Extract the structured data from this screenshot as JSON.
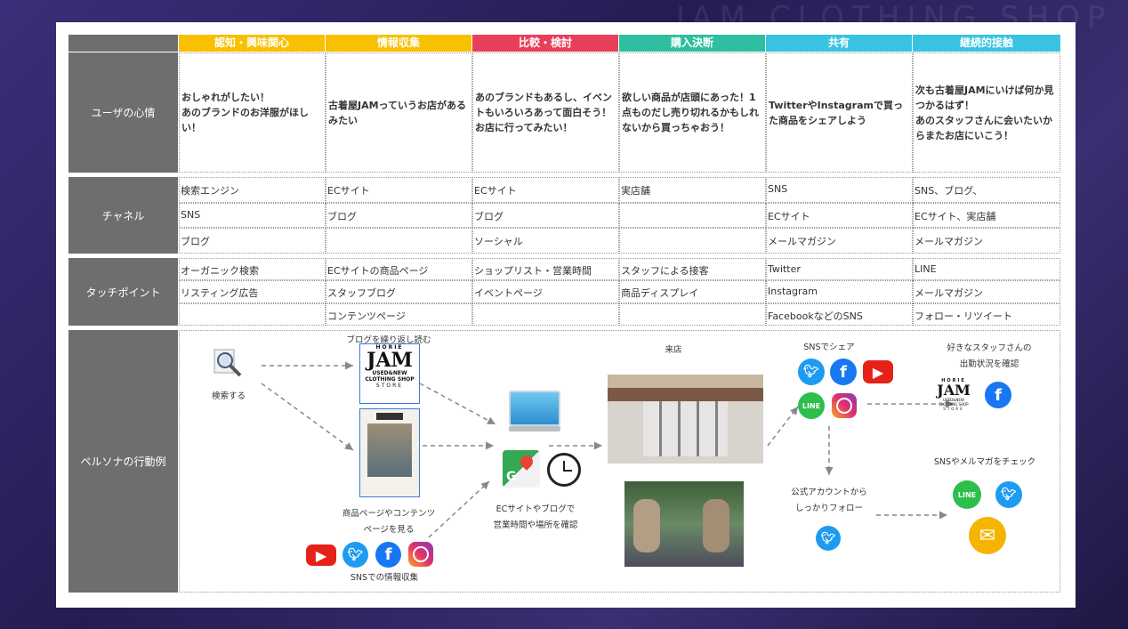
{
  "header": {
    "columns": [
      {
        "label": "認知・興味関心",
        "color": "#f7c000"
      },
      {
        "label": "情報収集",
        "color": "#f7c000"
      },
      {
        "label": "比較・検討",
        "color": "#e8405a"
      },
      {
        "label": "購入決断",
        "color": "#2fbfa0"
      },
      {
        "label": "共有",
        "color": "#38c3e0"
      },
      {
        "label": "継続的接触",
        "color": "#38c3e0"
      }
    ]
  },
  "rows": {
    "feelings": {
      "label": "ユーザの心情",
      "cells": [
        "おしゃれがしたい！\nあのブランドのお洋服がほしい！",
        "古着屋JAMっていうお店があるみたい",
        "あのブランドもあるし、イベントもいろいろあって面白そう！お店に行ってみたい！",
        "欲しい商品が店頭にあった！1点ものだし売り切れるかもしれないから買っちゃおう！",
        "TwitterやInstagramで買った商品をシェアしよう",
        "次も古着屋JAMにいけば何か見つかるはず！\nあのスタッフさんに会いたいからまたお店にいこう！"
      ]
    },
    "channel": {
      "label": "チャネル",
      "cells": [
        [
          "検索エンジン",
          "SNS",
          "ブログ"
        ],
        [
          "ECサイト",
          "ブログ",
          ""
        ],
        [
          "ECサイト",
          "ブログ",
          "ソーシャル"
        ],
        [
          "実店舗",
          "",
          ""
        ],
        [
          "SNS",
          "ECサイト",
          "メールマガジン"
        ],
        [
          "SNS、ブログ、",
          "ECサイト、実店舗",
          "メールマガジン"
        ]
      ]
    },
    "touchpoint": {
      "label": "タッチポイント",
      "cells": [
        [
          "オーガニック検索",
          "リスティング広告",
          ""
        ],
        [
          "ECサイトの商品ページ",
          "スタッフブログ",
          "コンテンツページ"
        ],
        [
          "ショップリスト・営業時間",
          "イベントページ",
          ""
        ],
        [
          "スタッフによる接客",
          "商品ディスプレイ",
          ""
        ],
        [
          "Twitter",
          "Instagram",
          "FacebookなどのSNS"
        ],
        [
          "LINE",
          "メールマガジン",
          "フォロー・リツイート"
        ]
      ]
    },
    "persona": {
      "label": "ペルソナの行動例"
    }
  },
  "persona": {
    "search": "検索する",
    "blog": "ブログを繰り返し読む",
    "logo": {
      "top": "HORIE",
      "main": "JAM",
      "sub1": "USED&NEW",
      "sub2": "CLOTHING SHOP",
      "bottom": "STORE"
    },
    "product_pages": "商品ページやコンテンツ\nページを見る",
    "sns_collect": "SNSでの情報収集",
    "ec_blog": "ECサイトやブログで\n営業時間や場所を確認",
    "visit": "来店",
    "sns_share": "SNSでシェア",
    "follow": "公式アカウントから\nしっかりフォロー",
    "staff": "好きなスタッフさんの\n出勤状況を確認",
    "check": "SNSやメルマガをチェック",
    "icons": {
      "youtube": "youtube-icon",
      "twitter": "twitter-icon",
      "facebook": "facebook-icon",
      "instagram": "instagram-icon",
      "line": "line-icon",
      "mail": "mail-icon",
      "search": "magnifier-icon",
      "maps": "maps-icon",
      "clock": "clock-icon",
      "desktop": "desktop-icon"
    },
    "line_text": "LINE"
  }
}
